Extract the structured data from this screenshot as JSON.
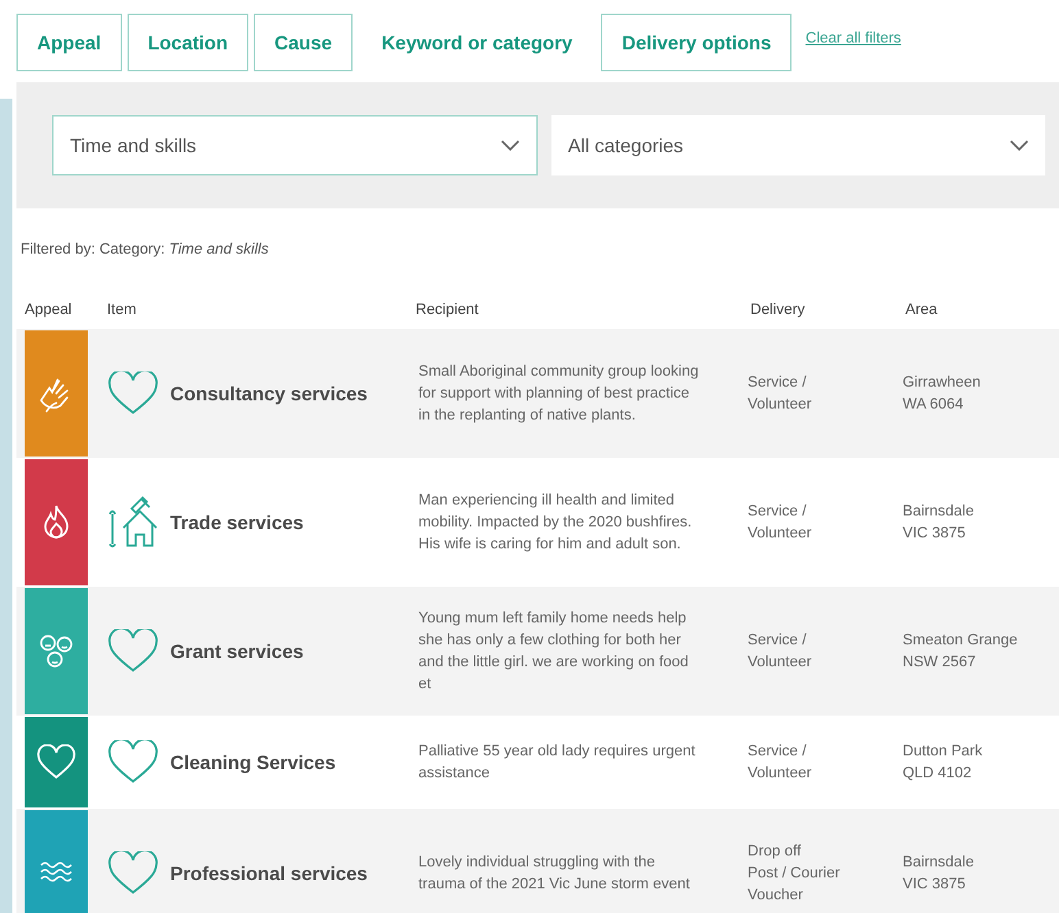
{
  "tabs": [
    {
      "label": "Appeal",
      "selected": false
    },
    {
      "label": "Location",
      "selected": false
    },
    {
      "label": "Cause",
      "selected": false
    },
    {
      "label": "Keyword or category",
      "selected": true
    },
    {
      "label": "Delivery options",
      "selected": false
    }
  ],
  "clear_filters": "Clear all filters",
  "dropdowns": [
    {
      "value": "Time and skills",
      "outlined": true
    },
    {
      "value": "All categories",
      "outlined": false
    }
  ],
  "filtered_by": "Filtered by: Category: *Time and skills*",
  "table": {
    "columns": [
      "Appeal",
      "Item",
      "Recipient",
      "Delivery",
      "Area"
    ],
    "rows": [
      {
        "appeal": {
          "kind": "hands",
          "color": "#e08a1e"
        },
        "item": {
          "kind": "heart",
          "name": "Consultancy services"
        },
        "recipient": "Small Aboriginal community group looking for support with planning of best practice in the replanting of native plants.",
        "delivery": [
          "Service / Volunteer"
        ],
        "area": [
          "Girrawheen",
          "WA 6064"
        ]
      },
      {
        "appeal": {
          "kind": "flame",
          "color": "#d23a4a"
        },
        "item": {
          "kind": "tools-house",
          "name": "Trade services"
        },
        "recipient": "Man experiencing ill health and limited mobility. Impacted by the 2020 bushfires. His wife is caring for him and adult son.",
        "delivery": [
          "Service / Volunteer"
        ],
        "area": [
          "Bairnsdale",
          "VIC 3875"
        ]
      },
      {
        "appeal": {
          "kind": "faces",
          "color": "#2eaea0"
        },
        "item": {
          "kind": "heart",
          "name": "Grant services"
        },
        "recipient": "Young mum left family home needs help she has only a few clothing for both her and the little girl. we are working on food et",
        "delivery": [
          "Service / Volunteer"
        ],
        "area": [
          "Smeaton Grange",
          "NSW 2567"
        ]
      },
      {
        "appeal": {
          "kind": "heart",
          "color": "#14937f"
        },
        "item": {
          "kind": "heart",
          "name": "Cleaning Services"
        },
        "recipient": "Palliative 55 year old lady requires urgent assistance",
        "delivery": [
          "Service / Volunteer"
        ],
        "area": [
          "Dutton Park",
          "QLD 4102"
        ]
      },
      {
        "appeal": {
          "kind": "waves",
          "color": "#1fa3b5"
        },
        "item": {
          "kind": "heart",
          "name": "Professional services"
        },
        "recipient": "Lovely individual struggling with the trauma of the 2021 Vic June storm event",
        "delivery": [
          "Drop off",
          "Post / Courier",
          "Voucher"
        ],
        "area": [
          "Bairnsdale",
          "VIC 3875"
        ]
      }
    ]
  }
}
